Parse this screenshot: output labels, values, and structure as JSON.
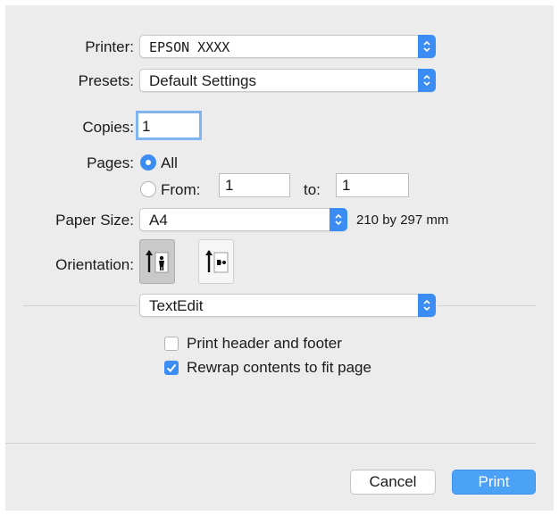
{
  "printer": {
    "label": "Printer:",
    "value": "EPSON XXXX"
  },
  "presets": {
    "label": "Presets:",
    "value": "Default Settings"
  },
  "copies": {
    "label": "Copies:",
    "value": "1"
  },
  "pages": {
    "label": "Pages:",
    "all_label": "All",
    "from_label": "From:",
    "from_value": "1",
    "to_label": "to:",
    "to_value": "1",
    "selected": "All"
  },
  "paper_size": {
    "label": "Paper Size:",
    "value": "A4",
    "dimensions": "210 by 297 mm"
  },
  "orientation": {
    "label": "Orientation:",
    "selected": "portrait",
    "icons": [
      "portrait-orientation-icon",
      "landscape-orientation-icon"
    ]
  },
  "app_menu": {
    "value": "TextEdit"
  },
  "options": [
    {
      "label": "Print header and footer",
      "checked": false
    },
    {
      "label": "Rewrap contents to fit page",
      "checked": true
    }
  ],
  "buttons": {
    "cancel": "Cancel",
    "print": "Print"
  },
  "colors": {
    "accent": "#3b8df4",
    "print_button": "#4aa1f5",
    "background": "#ececec"
  }
}
